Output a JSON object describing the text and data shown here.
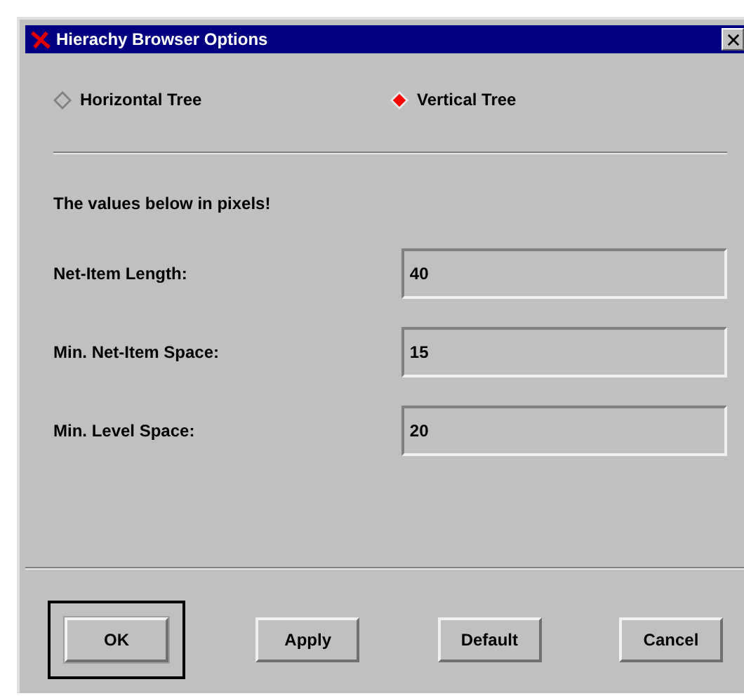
{
  "window": {
    "title": "Hierachy Browser Options"
  },
  "orientation": [
    {
      "label": "Horizontal Tree",
      "selected": false
    },
    {
      "label": "Vertical Tree",
      "selected": true
    }
  ],
  "note": "The values below in pixels!",
  "fields": [
    {
      "label": "Net-Item Length:",
      "value": "40"
    },
    {
      "label": "Min. Net-Item Space:",
      "value": "15"
    },
    {
      "label": "Min. Level Space:",
      "value": "20"
    }
  ],
  "buttons": [
    {
      "label": "OK",
      "default": true
    },
    {
      "label": "Apply",
      "default": false
    },
    {
      "label": "Default",
      "default": false
    },
    {
      "label": "Cancel",
      "default": false
    }
  ]
}
